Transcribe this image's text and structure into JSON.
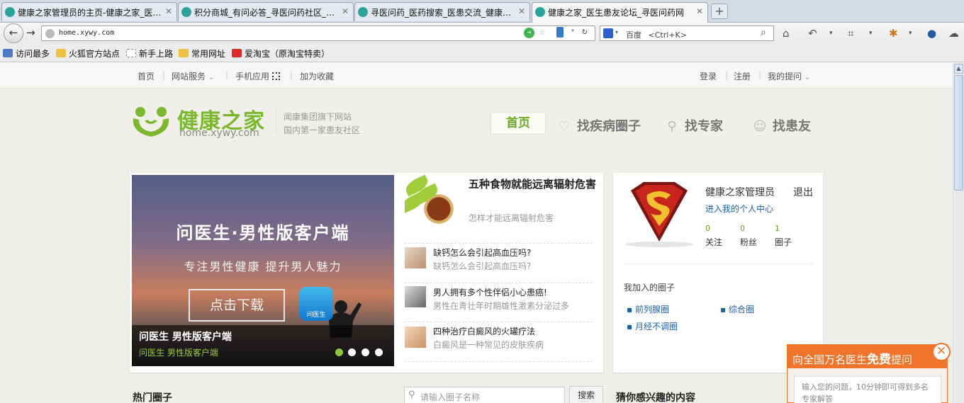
{
  "tabs": [
    {
      "title": "健康之家管理员的主页-健康之家_医…"
    },
    {
      "title": "积分商城_有问必答_寻医问药社区_…"
    },
    {
      "title": "寻医问药_医药搜索_医患交流_健康…"
    },
    {
      "title": "健康之家_医生患友论坛_寻医问药网"
    }
  ],
  "browser": {
    "url": "home.xywy.com",
    "search_engine": "百度",
    "search_shortcut": "<Ctrl+K>"
  },
  "bookmarks": [
    "访问最多",
    "火狐官方站点",
    "新手上路",
    "常用网址",
    "爱淘宝（原淘宝特卖）"
  ],
  "topnav": {
    "left": [
      "首页",
      "网站服务",
      "手机应用",
      "加为收藏"
    ],
    "right": [
      "登录",
      "注册",
      "我的提问"
    ]
  },
  "logo": {
    "title": "健康之家",
    "url": "home.xywy.com",
    "sub1": "闻康集团旗下网站",
    "sub2": "国内第一家患友社区"
  },
  "mainnav": [
    "首页",
    "找疾病圈子",
    "找专家",
    "找患友"
  ],
  "banner": {
    "title": "问医生·男性版客户端",
    "subtitle": "专注男性健康  提升男人魅力",
    "button": "点击下载",
    "app_label": "问医生",
    "caption": "问医生 男性版客户端",
    "caption_sub": "问医生 男性版客户端",
    "active_dot": 1,
    "dot_count": 4
  },
  "articles": [
    {
      "title": "五种食物就能远离辐射危害",
      "summary": "怎样才能远离辐射危害"
    },
    {
      "title": "缺钙怎么会引起高血压吗?",
      "summary": "缺钙怎么会引起高血压吗?"
    },
    {
      "title": "男人拥有多个性伴侣小心患癌!",
      "summary": "男性在青壮年时期雄性激素分泌过多"
    },
    {
      "title": "四种治疗白癜风的火罐疗法",
      "summary": "白癜风是一种常见的皮肤疾病"
    }
  ],
  "user": {
    "name": "健康之家管理员",
    "logout": "退出",
    "center_link": "进入我的个人中心",
    "stats": [
      {
        "label": "关注",
        "value": "0"
      },
      {
        "label": "粉丝",
        "value": "0"
      },
      {
        "label": "圈子",
        "value": "1"
      }
    ],
    "my_circles_title": "我加入的圈子",
    "circles": [
      "前列腺圈",
      "综合圈",
      "月经不调圈"
    ]
  },
  "sections": {
    "hot": "热门圈子",
    "search_placeholder": "请输入圈子名称",
    "search_button": "搜索",
    "guess": "猜你感兴趣的内容"
  },
  "ask": {
    "head_pre": "向全国万名医生",
    "head_bold": "免费",
    "head_post": "提问",
    "placeholder": "输入您的问题，10分钟即可得到多名专家解答"
  },
  "colors": {
    "brand_green": "#7bb82e",
    "ask_orange": "#f0752a",
    "link_blue": "#1a60a8"
  }
}
